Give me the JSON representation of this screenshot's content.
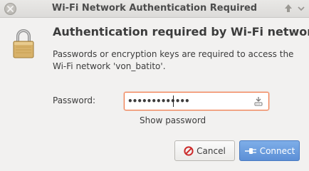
{
  "window": {
    "title": "Wi-Fi Network Authentication Required"
  },
  "dialog": {
    "heading": "Authentication required by Wi-Fi network",
    "message": "Passwords or encryption keys are required to access the Wi-Fi network 'von_batito'.",
    "password_label": "Password:",
    "password_masked": "•••••••••••••",
    "show_password_label": "Show password"
  },
  "buttons": {
    "cancel_label": "Cancel",
    "connect_label": "Connect"
  },
  "icons": {
    "close": "close-icon",
    "lock": "lock-icon",
    "keyboard": "keyboard-icon",
    "cancel": "cancel-icon",
    "connect": "connect-icon"
  },
  "colors": {
    "focus_border": "#f07746",
    "connect_button": "#5c8fd6",
    "cancel_icon": "#cc2a2a"
  }
}
